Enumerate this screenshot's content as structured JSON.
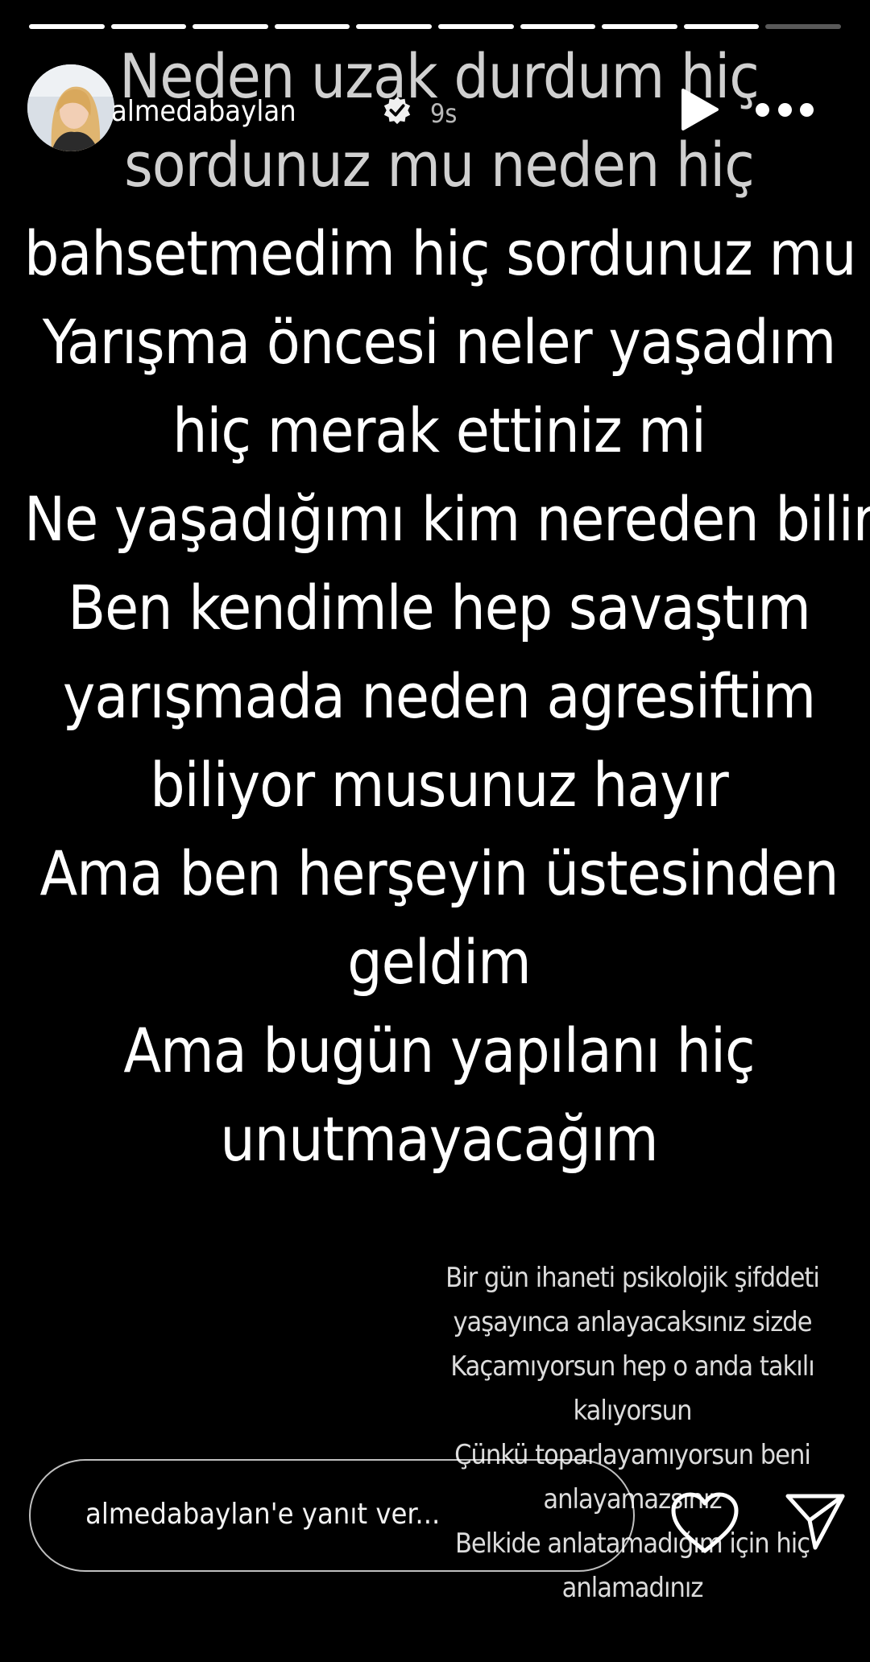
{
  "story": {
    "progress_segments": 10,
    "progress_completed": 9,
    "header": {
      "username": "almedabaylan",
      "time": "9s",
      "verified": true
    },
    "main_lines": [
      "Neden uzak durdum  hiç",
      "sordunuz mu neden hiç",
      "bahsetmedim hiç sordunuz mu",
      "Yarışma öncesi neler yaşadım",
      "hiç merak ettiniz mi",
      "Ne yaşadığımı kim nereden bilir",
      "Ben kendimle hep  savaştım",
      " yarışmada neden agresiftim",
      "biliyor musunuz hayır",
      "Ama ben herşeyin üstesinden",
      "geldim",
      "Ama bugün yapılanı hiç",
      "unutmayacağım"
    ],
    "small_lines": [
      "Bir gün ihaneti psikolojik şifddeti",
      "yaşayınca anlayacaksınız sizde",
      "Kaçamıyorsun hep o anda takılı",
      "kalıyorsun",
      "Çünkü toparlayamıyorsun beni",
      "anlayamazsınız",
      "Belkide anlatamadığım için hiç",
      "anlamadınız"
    ],
    "reply_placeholder": "almedabaylan'e yanıt ver...",
    "icons": [
      "avatar",
      "verified-badge-icon",
      "play-icon",
      "more-options-icon",
      "heart-icon",
      "send-icon"
    ],
    "colors": {
      "background": "#000000",
      "text": "#ffffff"
    }
  }
}
